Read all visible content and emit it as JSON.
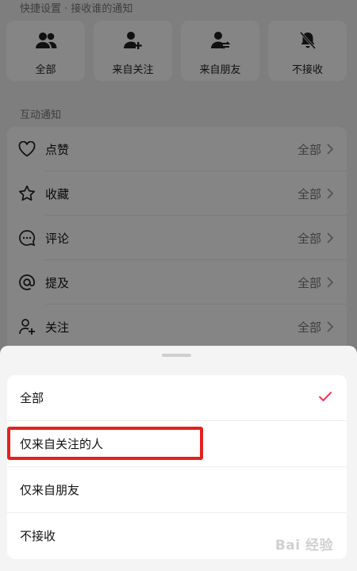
{
  "quick_settings": {
    "label": "快捷设置 · 接收谁的通知",
    "cards": [
      {
        "label": "全部",
        "icon": "people-icon"
      },
      {
        "label": "来自关注",
        "icon": "person-add-icon"
      },
      {
        "label": "来自朋友",
        "icon": "person-swap-icon"
      },
      {
        "label": "不接收",
        "icon": "bell-off-icon"
      }
    ]
  },
  "interaction": {
    "label": "互动通知",
    "rows": [
      {
        "name": "点赞",
        "value": "全部",
        "icon": "heart-icon"
      },
      {
        "name": "收藏",
        "value": "全部",
        "icon": "star-icon"
      },
      {
        "name": "评论",
        "value": "全部",
        "icon": "comment-icon"
      },
      {
        "name": "提及",
        "value": "全部",
        "icon": "at-icon"
      },
      {
        "name": "关注",
        "value": "全部",
        "icon": "person-add-icon"
      }
    ]
  },
  "sheet": {
    "options": [
      {
        "label": "全部",
        "selected": true
      },
      {
        "label": "仅来自关注的人",
        "selected": false
      },
      {
        "label": "仅来自朋友",
        "selected": false
      },
      {
        "label": "不接收",
        "selected": false
      }
    ]
  },
  "watermark": "Bai 经验",
  "colors": {
    "accent": "#fe2c55",
    "highlight": "#e5211e"
  }
}
